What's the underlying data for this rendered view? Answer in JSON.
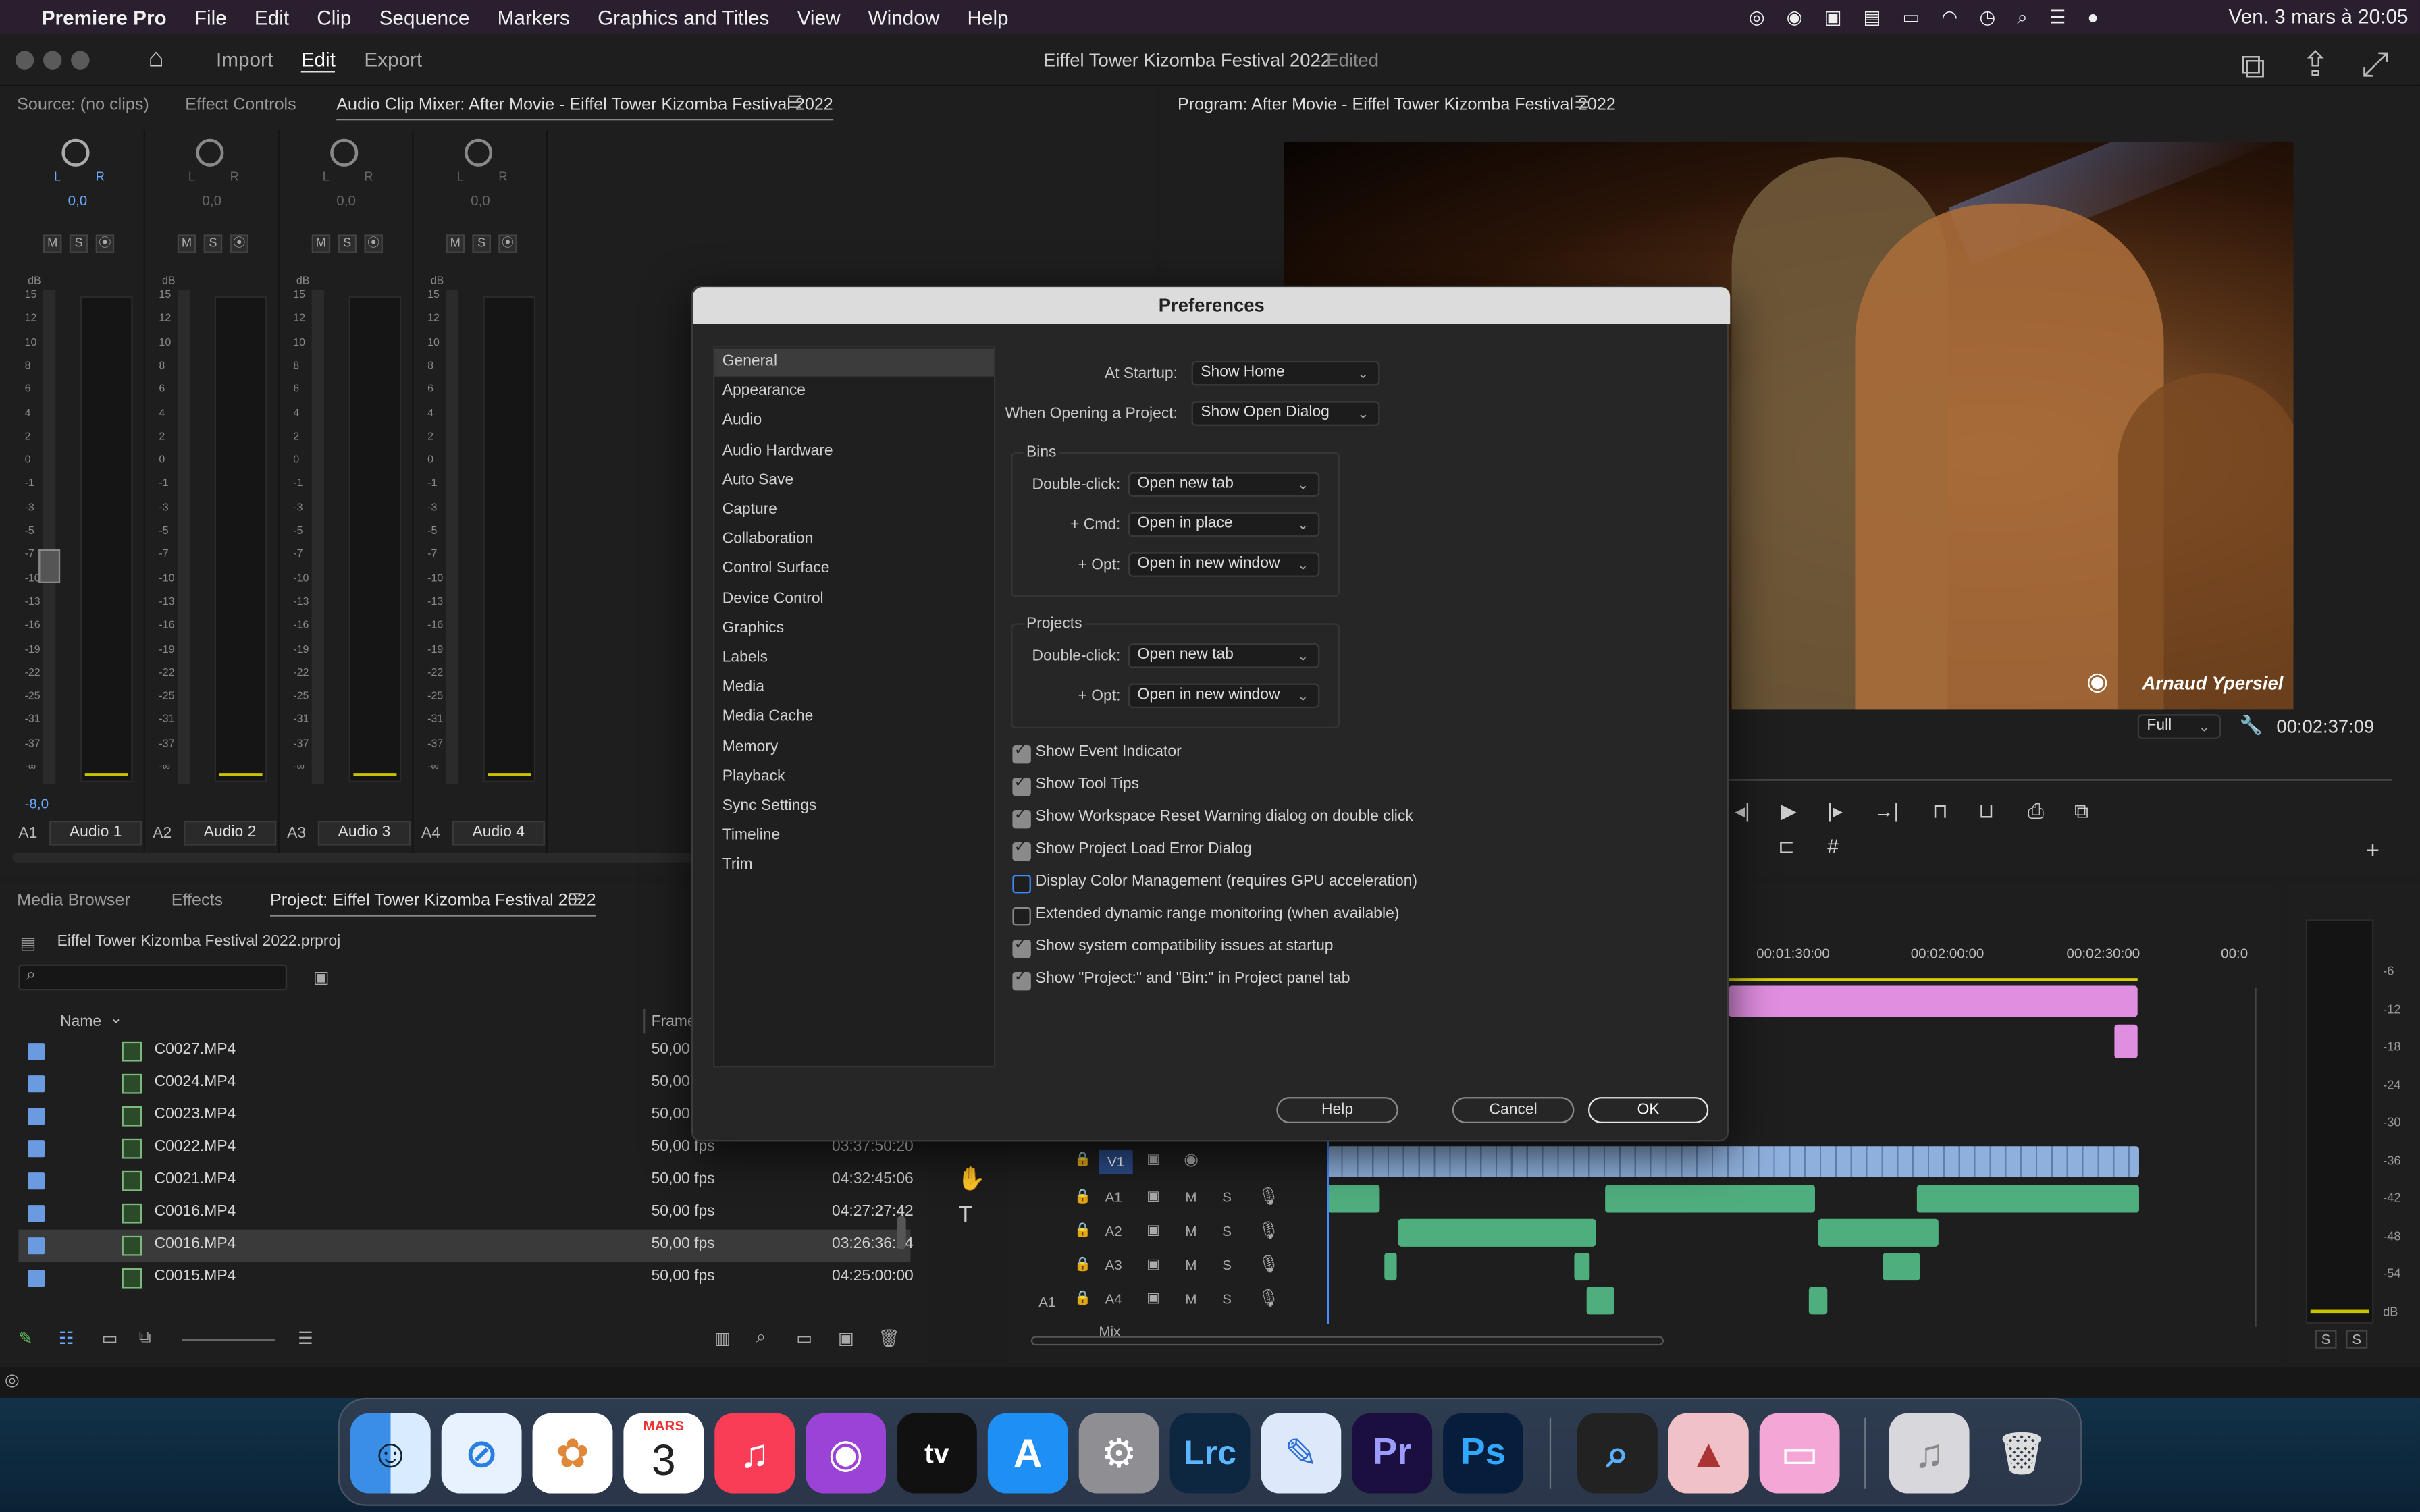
{
  "menubar": {
    "app": "Premiere Pro",
    "items": [
      "File",
      "Edit",
      "Clip",
      "Sequence",
      "Markers",
      "Graphics and Titles",
      "View",
      "Window",
      "Help"
    ],
    "clock": "Ven. 3 mars à 20:05"
  },
  "header": {
    "nav": [
      "Import",
      "Edit",
      "Export"
    ],
    "active_nav": "Edit",
    "project_title": "Eiffel Tower Kizomba Festival 2022",
    "status": "- Edited"
  },
  "source_panel": {
    "tabs": [
      "Source: (no clips)",
      "Effect Controls",
      "Audio Clip Mixer: After Movie - Eiffel Tower Kizomba Festival 2022"
    ],
    "channels": [
      {
        "id": "A1",
        "name": "Audio 1",
        "pan": "0,0",
        "fader_value": "-8,0"
      },
      {
        "id": "A2",
        "name": "Audio 2",
        "pan": "0,0"
      },
      {
        "id": "A3",
        "name": "Audio 3",
        "pan": "0,0"
      },
      {
        "id": "A4",
        "name": "Audio 4",
        "pan": "0,0"
      }
    ],
    "db_label": "dB",
    "db_ticks": [
      "15",
      "12",
      "10",
      "8",
      "6",
      "4",
      "2",
      "0",
      "-1",
      "-3",
      "-5",
      "-7",
      "-10",
      "-13",
      "-16",
      "-19",
      "-22",
      "-25",
      "-31",
      "-37",
      "-∞"
    ],
    "lr": "L",
    "rr": "R"
  },
  "program_monitor": {
    "title": "Program: After Movie - Eiffel Tower Kizomba Festival 2022",
    "watermark": "Arnaud Ypersiel",
    "zoom": "Full",
    "timecode": "00:02:37:09"
  },
  "preferences": {
    "title": "Preferences",
    "categories": [
      "General",
      "Appearance",
      "Audio",
      "Audio Hardware",
      "Auto Save",
      "Capture",
      "Collaboration",
      "Control Surface",
      "Device Control",
      "Graphics",
      "Labels",
      "Media",
      "Media Cache",
      "Memory",
      "Playback",
      "Sync Settings",
      "Timeline",
      "Trim"
    ],
    "selected_category": "General",
    "at_startup_label": "At Startup:",
    "at_startup_value": "Show Home",
    "opening_project_label": "When Opening a Project:",
    "opening_project_value": "Show Open Dialog",
    "bins": {
      "title": "Bins",
      "double_click_label": "Double-click:",
      "double_click_value": "Open new tab",
      "cmd_label": "+ Cmd:",
      "cmd_value": "Open in place",
      "opt_label": "+ Opt:",
      "opt_value": "Open in new window"
    },
    "projects": {
      "title": "Projects",
      "double_click_label": "Double-click:",
      "double_click_value": "Open new tab",
      "opt_label": "+ Opt:",
      "opt_value": "Open in new window"
    },
    "checkboxes": [
      {
        "label": "Show Event Indicator",
        "checked": true
      },
      {
        "label": "Show Tool Tips",
        "checked": true
      },
      {
        "label": "Show Workspace Reset Warning dialog on double click",
        "checked": true
      },
      {
        "label": "Show Project Load Error Dialog",
        "checked": true
      },
      {
        "label": "Display Color Management (requires GPU acceleration)",
        "checked": false
      },
      {
        "label": "Extended dynamic range monitoring (when available)",
        "checked": false
      },
      {
        "label": "Show system compatibility issues at startup",
        "checked": true
      },
      {
        "label": "Show \"Project:\" and \"Bin:\" in Project panel tab",
        "checked": true
      }
    ],
    "help_label": "Help",
    "cancel_label": "Cancel",
    "ok_label": "OK"
  },
  "project_panel": {
    "tabs": [
      "Media Browser",
      "Effects",
      "Project: Eiffel Tower Kizomba Festival 2022"
    ],
    "file": "Eiffel Tower Kizomba Festival 2022.prproj",
    "col_name": "Name",
    "col_frame": "Frame",
    "rows": [
      {
        "name": "C0027.MP4",
        "fps": "50,00",
        "duration": ""
      },
      {
        "name": "C0024.MP4",
        "fps": "50,00",
        "duration": ""
      },
      {
        "name": "C0023.MP4",
        "fps": "50,00",
        "duration": ""
      },
      {
        "name": "C0022.MP4",
        "fps": "50,00 fps",
        "duration": "03:37:50:20"
      },
      {
        "name": "C0021.MP4",
        "fps": "50,00 fps",
        "duration": "04:32:45:06"
      },
      {
        "name": "C0016.MP4",
        "fps": "50,00 fps",
        "duration": "04:27:27:42"
      },
      {
        "name": "C0016.MP4",
        "fps": "50,00 fps",
        "duration": "03:26:36:24"
      },
      {
        "name": "C0015.MP4",
        "fps": "50,00 fps",
        "duration": "04:25:00:00"
      }
    ],
    "selected_row": 6
  },
  "timeline": {
    "ruler": [
      "00:01:30:00",
      "00:02:00:00",
      "00:02:30:00",
      "00:0"
    ],
    "tracks": [
      {
        "id": "V1"
      },
      {
        "id": "A1"
      },
      {
        "id": "A2"
      },
      {
        "id": "A3"
      },
      {
        "id": "A4"
      }
    ],
    "mix_label": "Mix",
    "m": "M",
    "s": "S",
    "source_patch": "A1"
  },
  "audio_meter": {
    "ticks": [
      "-6",
      "-12",
      "-18",
      "-24",
      "-30",
      "-36",
      "-42",
      "-48",
      "-54",
      "dB"
    ],
    "solo": [
      "S",
      "S"
    ]
  },
  "dock": {
    "calendar_month": "MARS",
    "calendar_day": "3",
    "apps": [
      "Finder",
      "Safari",
      "Photos",
      "Calendar",
      "Music",
      "Podcasts",
      "Apple TV",
      "App Store",
      "System Settings",
      "Lrc",
      "TextEdit",
      "Pr",
      "Ps",
      "QuickTime",
      "Affinity",
      "CleanMyMac",
      "Music folder",
      "Trash"
    ],
    "lrc": "Lrc",
    "pr": "Pr",
    "ps": "Ps",
    "tv": "tv"
  },
  "colors": {
    "accent_blue": "#3d8bff",
    "meter_yellow": "#c9c400",
    "audio_clip": "#4fae7e",
    "video_clip": "#8fb0dc",
    "pink_clip": "#e08fe0"
  }
}
